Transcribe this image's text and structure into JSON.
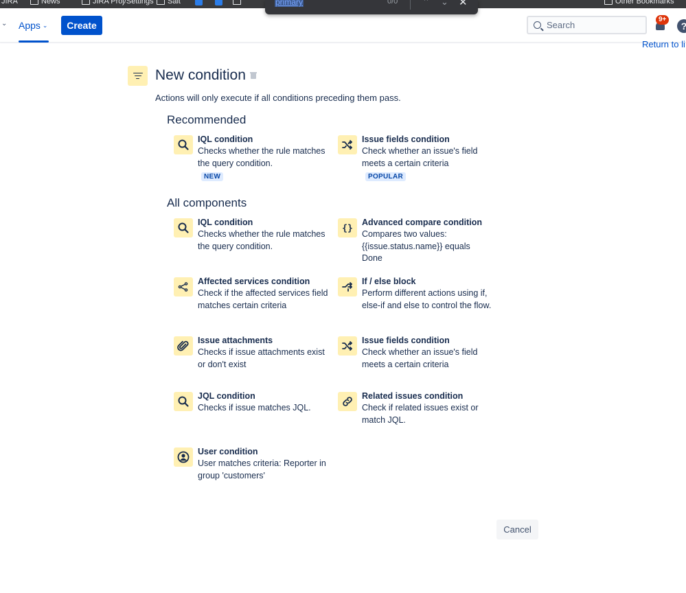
{
  "browser": {
    "bookmarks": [
      "News",
      "JIRA Proj/Settings",
      "Salt",
      "Other Bookmarks"
    ],
    "find_query": "primary",
    "find_count": "0/0"
  },
  "nav": {
    "apps_label": "Apps",
    "create_label": "Create",
    "search_placeholder": "Search",
    "notification_count": "9+",
    "help_label": "?",
    "return_link": "Return to li"
  },
  "page": {
    "title": "New condition",
    "subtitle": "Actions will only execute if all conditions preceding them pass."
  },
  "recommended": {
    "title": "Recommended",
    "items": [
      {
        "name": "IQL condition",
        "desc": "Checks whether the rule matches the query condition.",
        "badge": "NEW",
        "icon": "search-icon"
      },
      {
        "name": "Issue fields condition",
        "desc": "Check whether an issue's field meets a certain criteria",
        "badge": "POPULAR",
        "icon": "shuffle-icon"
      }
    ]
  },
  "all_components": {
    "title": "All components",
    "items": [
      {
        "name": "IQL condition",
        "desc": "Checks whether the rule matches the query condition.",
        "icon": "search-icon"
      },
      {
        "name": "Advanced compare condition",
        "desc": "Compares two values: {{issue.status.name}} equals Done",
        "icon": "braces-icon"
      },
      {
        "name": "Affected services condition",
        "desc": "Check if the affected services field matches certain criteria",
        "icon": "services-icon"
      },
      {
        "name": "If / else block",
        "desc": "Perform different actions using if, else-if and else to control the flow.",
        "icon": "branch-icon"
      },
      {
        "name": "Issue attachments",
        "desc": "Checks if issue attachments exist or don't exist",
        "icon": "paperclip-icon"
      },
      {
        "name": "Issue fields condition",
        "desc": "Check whether an issue's field meets a certain criteria",
        "icon": "shuffle-icon"
      },
      {
        "name": "JQL condition",
        "desc": "Checks if issue matches JQL.",
        "icon": "search-icon"
      },
      {
        "name": "Related issues condition",
        "desc": "Check if related issues exist or match JQL.",
        "icon": "link-icon"
      },
      {
        "name": "User condition",
        "desc": "User matches criteria: Reporter in group 'customers'",
        "icon": "user-icon"
      }
    ]
  },
  "footer": {
    "cancel_label": "Cancel"
  },
  "colors": {
    "primary": "#0052cc",
    "icon_bg": "#fff0b3",
    "badge_bg": "#deebff",
    "badge_text": "#0747a6",
    "notification": "#de350b"
  }
}
